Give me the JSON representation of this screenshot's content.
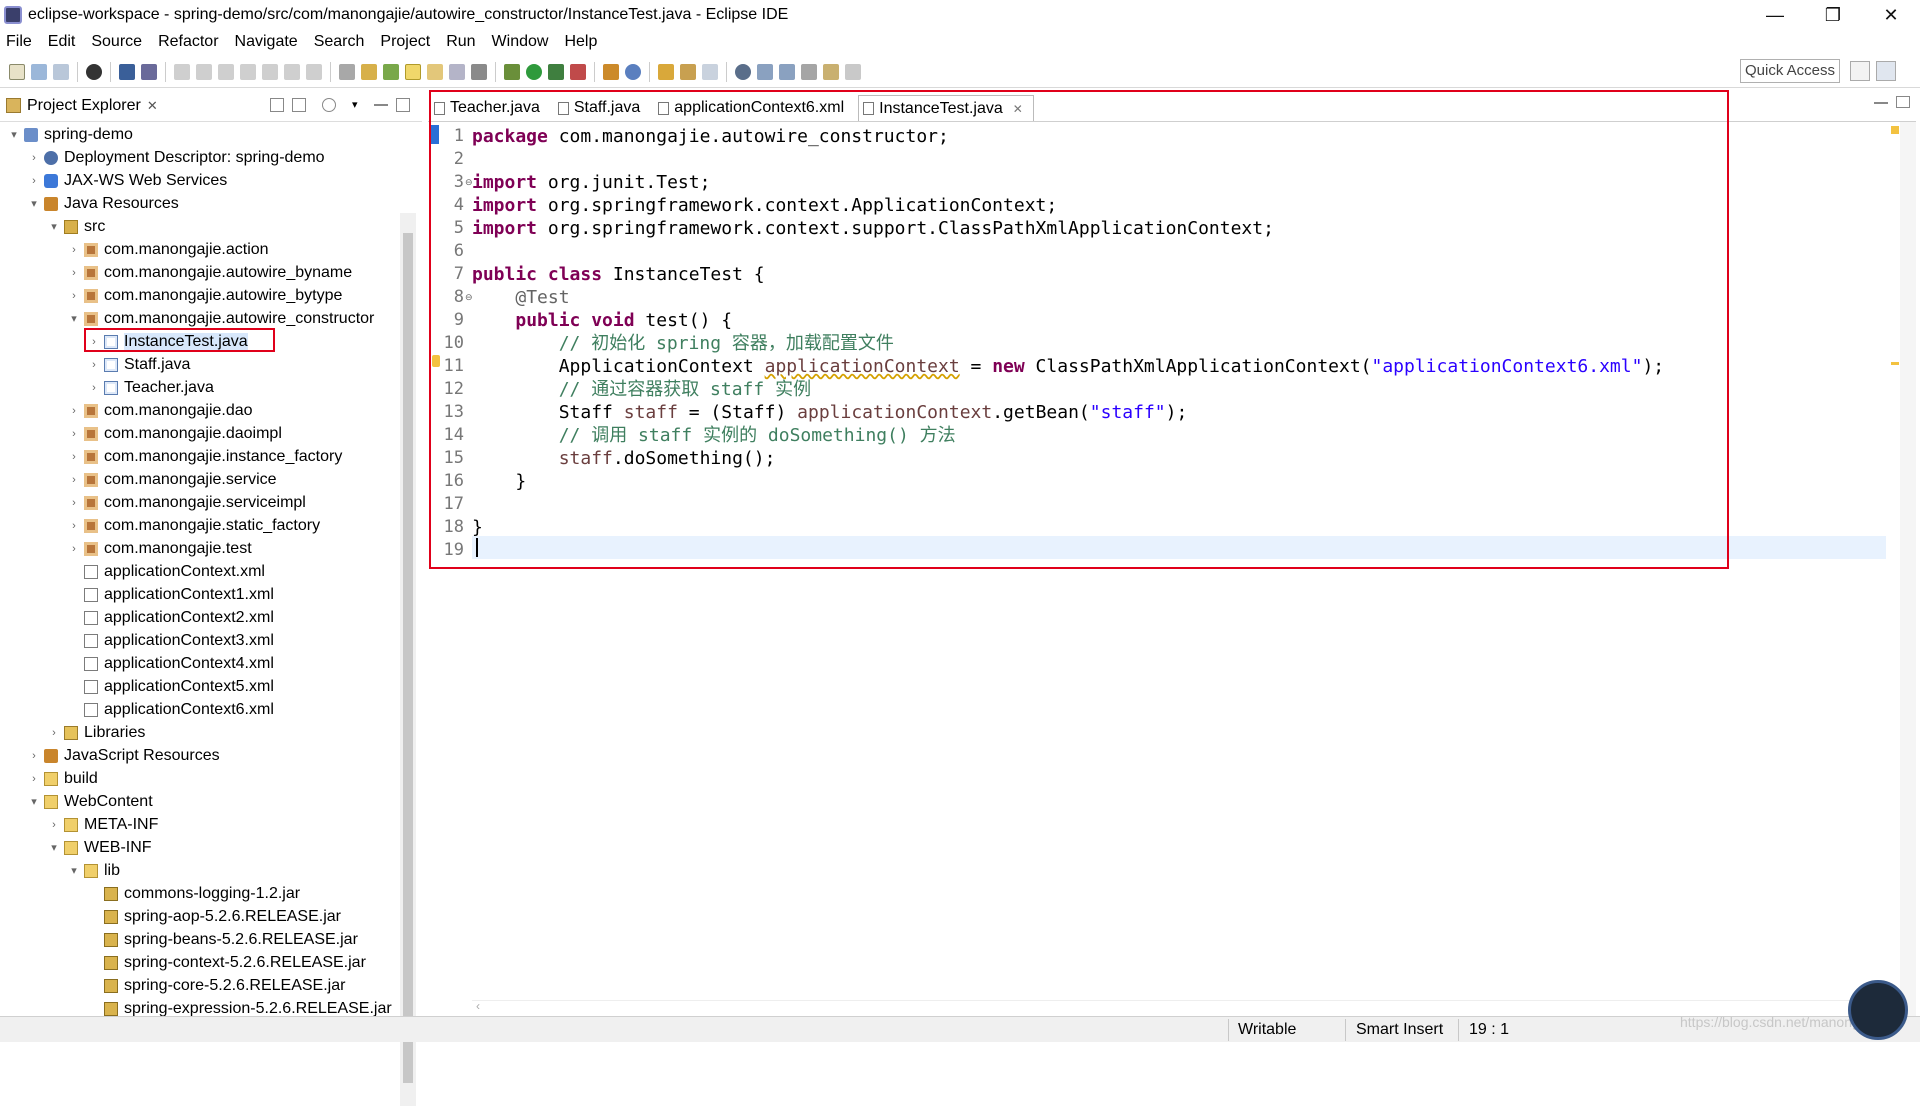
{
  "window": {
    "title": "eclipse-workspace - spring-demo/src/com/manongajie/autowire_constructor/InstanceTest.java - Eclipse IDE",
    "minimize": "—",
    "maximize": "❐",
    "close": "✕"
  },
  "menu": [
    "File",
    "Edit",
    "Source",
    "Refactor",
    "Navigate",
    "Search",
    "Project",
    "Run",
    "Window",
    "Help"
  ],
  "toolbar": {
    "quick_access_placeholder": "Quick Access"
  },
  "explorer": {
    "title": "Project Explorer",
    "close": "✕",
    "tree": [
      {
        "label": "spring-demo",
        "arrow": "▾",
        "icon": "project-icon"
      },
      {
        "label": "Deployment Descriptor: spring-demo",
        "arrow": "›",
        "icon": "deployment-descriptor-icon"
      },
      {
        "label": "JAX-WS Web Services",
        "arrow": "›",
        "icon": "web-services-icon"
      },
      {
        "label": "Java Resources",
        "arrow": "▾",
        "icon": "java-resources-icon"
      },
      {
        "label": "src",
        "arrow": "▾",
        "icon": "source-folder-icon"
      },
      {
        "label": "com.manongajie.action",
        "arrow": "›",
        "icon": "package-icon"
      },
      {
        "label": "com.manongajie.autowire_byname",
        "arrow": "›",
        "icon": "package-icon"
      },
      {
        "label": "com.manongajie.autowire_bytype",
        "arrow": "›",
        "icon": "package-icon"
      },
      {
        "label": "com.manongajie.autowire_constructor",
        "arrow": "▾",
        "icon": "package-icon"
      },
      {
        "label": "InstanceTest.java",
        "arrow": "›",
        "icon": "java-file-icon"
      },
      {
        "label": "Staff.java",
        "arrow": "›",
        "icon": "java-file-icon"
      },
      {
        "label": "Teacher.java",
        "arrow": "›",
        "icon": "java-file-icon"
      },
      {
        "label": "com.manongajie.dao",
        "arrow": "›",
        "icon": "package-icon"
      },
      {
        "label": "com.manongajie.daoimpl",
        "arrow": "›",
        "icon": "package-icon"
      },
      {
        "label": "com.manongajie.instance_factory",
        "arrow": "›",
        "icon": "package-icon"
      },
      {
        "label": "com.manongajie.service",
        "arrow": "›",
        "icon": "package-icon"
      },
      {
        "label": "com.manongajie.serviceimpl",
        "arrow": "›",
        "icon": "package-icon"
      },
      {
        "label": "com.manongajie.static_factory",
        "arrow": "›",
        "icon": "package-icon"
      },
      {
        "label": "com.manongajie.test",
        "arrow": "›",
        "icon": "package-icon"
      },
      {
        "label": "applicationContext.xml",
        "arrow": "",
        "icon": "xml-file-icon"
      },
      {
        "label": "applicationContext1.xml",
        "arrow": "",
        "icon": "xml-file-icon"
      },
      {
        "label": "applicationContext2.xml",
        "arrow": "",
        "icon": "xml-file-icon"
      },
      {
        "label": "applicationContext3.xml",
        "arrow": "",
        "icon": "xml-file-icon"
      },
      {
        "label": "applicationContext4.xml",
        "arrow": "",
        "icon": "xml-file-icon"
      },
      {
        "label": "applicationContext5.xml",
        "arrow": "",
        "icon": "xml-file-icon"
      },
      {
        "label": "applicationContext6.xml",
        "arrow": "",
        "icon": "xml-file-icon"
      },
      {
        "label": "Libraries",
        "arrow": "›",
        "icon": "libraries-icon"
      },
      {
        "label": "JavaScript Resources",
        "arrow": "›",
        "icon": "javascript-resources-icon"
      },
      {
        "label": "build",
        "arrow": "›",
        "icon": "folder-icon"
      },
      {
        "label": "WebContent",
        "arrow": "▾",
        "icon": "folder-icon"
      },
      {
        "label": "META-INF",
        "arrow": "›",
        "icon": "folder-icon"
      },
      {
        "label": "WEB-INF",
        "arrow": "▾",
        "icon": "folder-icon"
      },
      {
        "label": "lib",
        "arrow": "▾",
        "icon": "folder-icon"
      },
      {
        "label": "commons-logging-1.2.jar",
        "arrow": "",
        "icon": "jar-icon"
      },
      {
        "label": "spring-aop-5.2.6.RELEASE.jar",
        "arrow": "",
        "icon": "jar-icon"
      },
      {
        "label": "spring-beans-5.2.6.RELEASE.jar",
        "arrow": "",
        "icon": "jar-icon"
      },
      {
        "label": "spring-context-5.2.6.RELEASE.jar",
        "arrow": "",
        "icon": "jar-icon"
      },
      {
        "label": "spring-core-5.2.6.RELEASE.jar",
        "arrow": "",
        "icon": "jar-icon"
      },
      {
        "label": "spring-expression-5.2.6.RELEASE.jar",
        "arrow": "",
        "icon": "jar-icon"
      }
    ],
    "selected": "InstanceTest.java"
  },
  "editor": {
    "tabs": [
      {
        "label": "Teacher.java",
        "active": false
      },
      {
        "label": "Staff.java",
        "active": false
      },
      {
        "label": "applicationContext6.xml",
        "active": false
      },
      {
        "label": "InstanceTest.java",
        "active": true
      }
    ],
    "tab_close": "✕",
    "line_numbers": [
      "1",
      "2",
      "3",
      "4",
      "5",
      "6",
      "7",
      "8",
      "9",
      "10",
      "11",
      "12",
      "13",
      "14",
      "15",
      "16",
      "17",
      "18",
      "19"
    ],
    "code": {
      "l1_kw": "package",
      "l1_rest": " com.manongajie.autowire_constructor;",
      "l3_kw": "import",
      "l3_rest": " org.junit.Test;",
      "l4_kw": "import",
      "l4_rest": " org.springframework.context.ApplicationContext;",
      "l5_kw": "import",
      "l5_rest": " org.springframework.context.support.ClassPathXmlApplicationContext;",
      "l7_kw": "public class",
      "l7_rest": " InstanceTest {",
      "l8_ann": "@Test",
      "l9_kw": "public void",
      "l9_rest": " test() {",
      "l10_cm": "// 初始化 spring 容器，加载配置文件",
      "l11_a": "ApplicationContext ",
      "l11_var": "applicationContext",
      "l11_b": " = ",
      "l11_kw": "new",
      "l11_c": " ClassPathXmlApplicationContext(",
      "l11_str": "\"applicationContext6.xml\"",
      "l11_d": ");",
      "l12_cm": "// 通过容器获取 staff 实例",
      "l13_a": "Staff ",
      "l13_var": "staff",
      "l13_b": " = (Staff) ",
      "l13_var2": "applicationContext",
      "l13_c": ".getBean(",
      "l13_str": "\"staff\"",
      "l13_d": ");",
      "l14_cm": "// 调用 staff 实例的 doSomething() 方法",
      "l15_var": "staff",
      "l15_rest": ".doSomething();",
      "l16": "}",
      "l18": "}"
    }
  },
  "status": {
    "writable": "Writable",
    "insert_mode": "Smart Insert",
    "position": "19 : 1"
  },
  "watermark": "https://blog.csdn.net/manongajie",
  "colors": {
    "keyword": "#7f0055",
    "comment": "#3f7f5f",
    "string": "#2a00ff",
    "annotation_highlight": "#e0001a",
    "current_line": "#e8f2fe"
  }
}
